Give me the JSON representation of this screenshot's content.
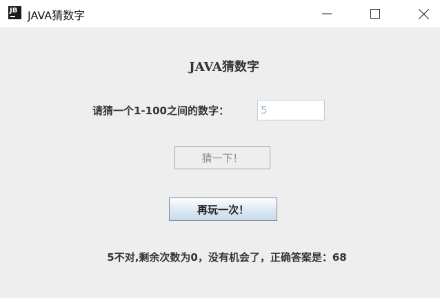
{
  "window": {
    "title": "JAVA猜数字",
    "icon": "jetbrains-app-icon",
    "icon_text": "JB",
    "controls": [
      "minimize-icon",
      "maximize-icon",
      "close-icon"
    ]
  },
  "main": {
    "heading": "JAVA猜数字",
    "prompt_label": "请猜一个1-100之间的数字：",
    "guess_input_value": "5",
    "guess_button_label": "猜一下！",
    "replay_button_label": "再玩一次！",
    "result_text": "5不对,剩余次数为0，没有机会了，正确答案是：68"
  }
}
